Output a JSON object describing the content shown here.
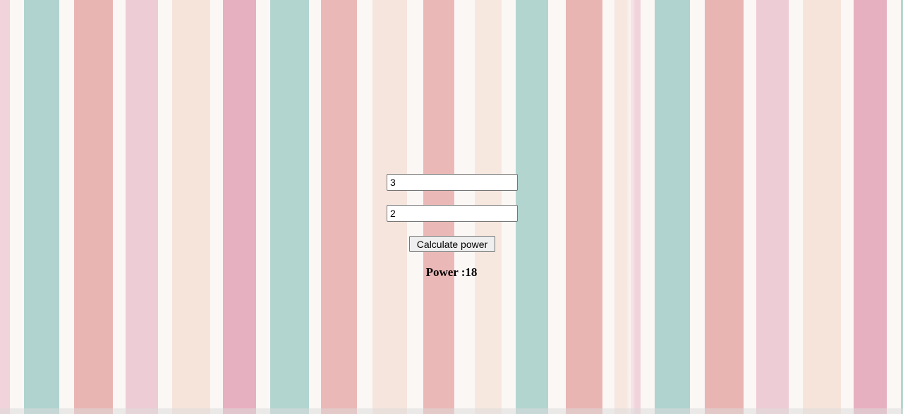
{
  "background": {
    "palette": {
      "teal": "#a9d3cd",
      "coral": "#eba9a6",
      "pink": "#eaa7bd",
      "peach": "#f6d7c8",
      "blush": "#f4c4cc"
    }
  },
  "calculator": {
    "base_value": "3",
    "exponent_value": "2",
    "button_label": "Calculate power",
    "result_label": "Power :",
    "result_value": "18"
  }
}
